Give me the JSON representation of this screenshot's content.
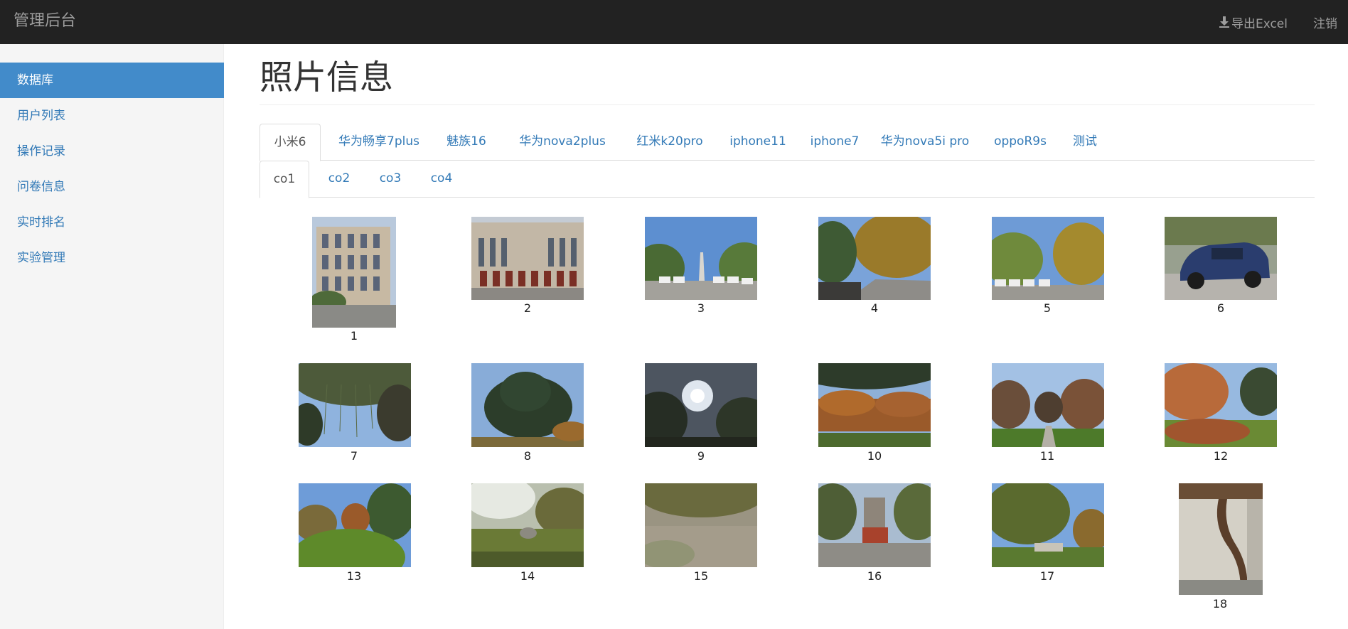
{
  "app": {
    "brand": "管理后台"
  },
  "header": {
    "export_label": "导出Excel",
    "logout_label": "注销"
  },
  "sidebar": {
    "items": [
      {
        "label": "数据库",
        "active": true
      },
      {
        "label": "用户列表"
      },
      {
        "label": "操作记录"
      },
      {
        "label": "问卷信息"
      },
      {
        "label": "实时排名"
      },
      {
        "label": "实验管理"
      }
    ]
  },
  "page": {
    "title": "照片信息"
  },
  "device_tabs": [
    {
      "label": "小米6",
      "active": true
    },
    {
      "label": "华为畅享7plus"
    },
    {
      "label": "魅族16"
    },
    {
      "label": "华为nova2plus"
    },
    {
      "label": "红米k20pro"
    },
    {
      "label": "iphone11"
    },
    {
      "label": "iphone7"
    },
    {
      "label": "华为nova5i pro"
    },
    {
      "label": "oppoR9s"
    },
    {
      "label": "测试"
    }
  ],
  "sub_tabs": [
    {
      "label": "co1",
      "active": true
    },
    {
      "label": "co2"
    },
    {
      "label": "co3"
    },
    {
      "label": "co4"
    }
  ],
  "photos": [
    {
      "caption": "1",
      "scene": "building",
      "orientation": "portrait"
    },
    {
      "caption": "2",
      "scene": "building",
      "orientation": "landscape"
    },
    {
      "caption": "3",
      "scene": "parking",
      "orientation": "landscape"
    },
    {
      "caption": "4",
      "scene": "road-trees",
      "orientation": "landscape"
    },
    {
      "caption": "5",
      "scene": "parking-trees",
      "orientation": "landscape"
    },
    {
      "caption": "6",
      "scene": "car",
      "orientation": "landscape"
    },
    {
      "caption": "7",
      "scene": "willow-sky",
      "orientation": "landscape"
    },
    {
      "caption": "8",
      "scene": "pine",
      "orientation": "landscape"
    },
    {
      "caption": "9",
      "scene": "sun-trees",
      "orientation": "landscape"
    },
    {
      "caption": "10",
      "scene": "autumn-trees",
      "orientation": "landscape"
    },
    {
      "caption": "11",
      "scene": "path-trees",
      "orientation": "landscape"
    },
    {
      "caption": "12",
      "scene": "autumn-lawn",
      "orientation": "landscape"
    },
    {
      "caption": "13",
      "scene": "shrubs",
      "orientation": "landscape"
    },
    {
      "caption": "14",
      "scene": "hazy-garden",
      "orientation": "landscape"
    },
    {
      "caption": "15",
      "scene": "ground",
      "orientation": "landscape"
    },
    {
      "caption": "16",
      "scene": "statue",
      "orientation": "landscape"
    },
    {
      "caption": "17",
      "scene": "garden-trees",
      "orientation": "landscape"
    },
    {
      "caption": "18",
      "scene": "tree-wall",
      "orientation": "portrait"
    }
  ],
  "icons": {
    "export": "download-icon"
  },
  "colors": {
    "navbar": "#222222",
    "accent": "#428bca",
    "link": "#337ab7",
    "sidebar": "#f5f5f5"
  }
}
